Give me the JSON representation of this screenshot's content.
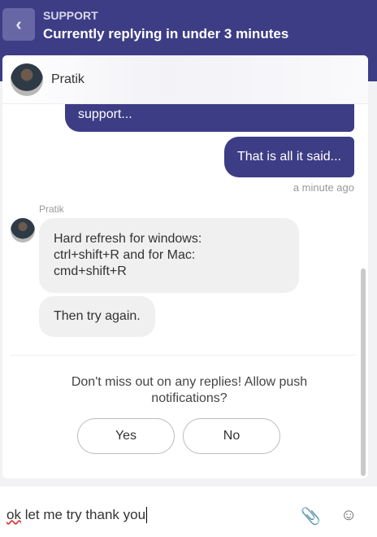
{
  "header": {
    "back_label": "<",
    "subtitle": "SUPPORT",
    "title": "Currently replying in under 3 minutes"
  },
  "agent": {
    "name": "Pratik"
  },
  "messages": {
    "out1": "support...",
    "out2": "That is all it said...",
    "out_time": "a minute ago",
    "sender": "Pratik",
    "in1_l1": "Hard refresh for windows:",
    "in1_l2": "ctrl+shift+R and for Mac:",
    "in1_l3": "cmd+shift+R",
    "in2": "Then try again."
  },
  "notification": {
    "prompt": "Don't miss out on any replies! Allow push notifications?",
    "yes": "Yes",
    "no": "No"
  },
  "composer": {
    "value_misspelled": "ok",
    "value_rest": " let me try thank you"
  },
  "icons": {
    "attach": "paperclip-icon",
    "emoji": "smiley-icon"
  }
}
